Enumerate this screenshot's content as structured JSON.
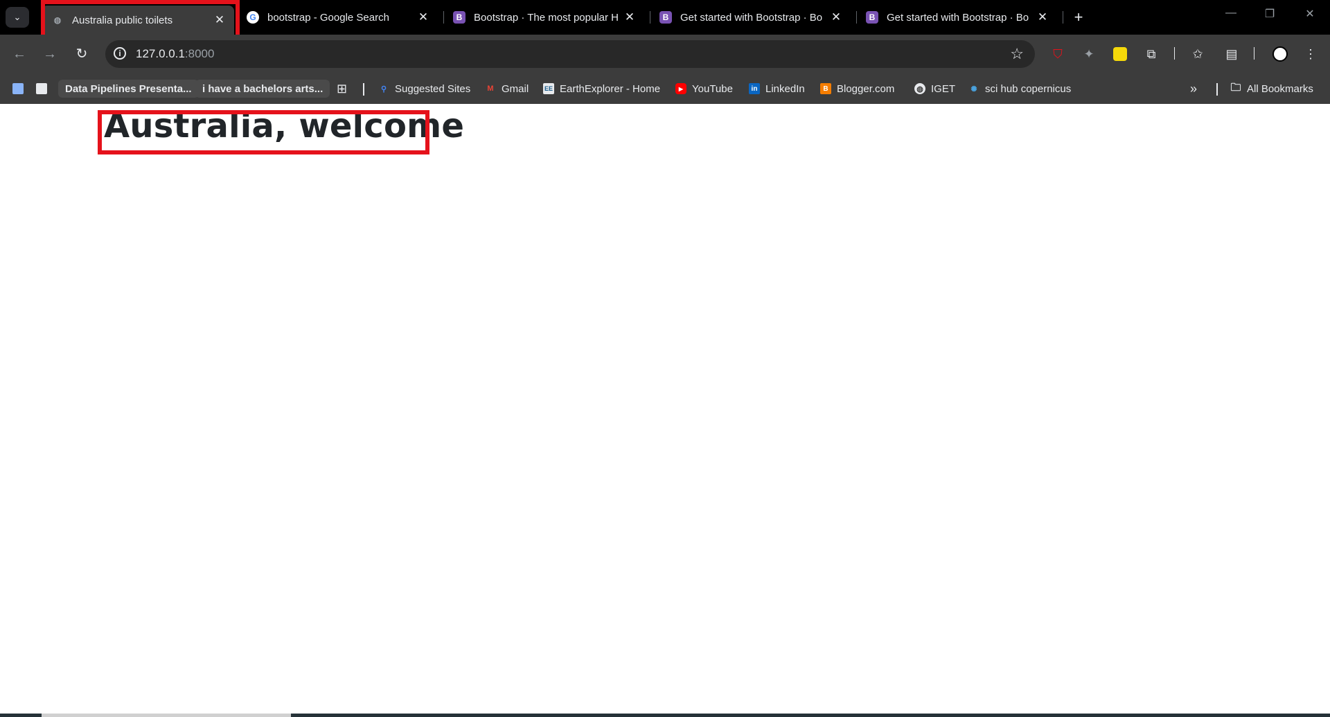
{
  "browser": {
    "tabs": [
      {
        "title": "Australia public toilets",
        "favicon": "globe-icon",
        "active": true
      },
      {
        "title": "bootstrap - Google Search",
        "favicon": "google-icon",
        "active": false
      },
      {
        "title": "Bootstrap · The most popular H",
        "favicon": "bootstrap-icon",
        "active": false
      },
      {
        "title": "Get started with Bootstrap · Bo",
        "favicon": "bootstrap-icon",
        "active": false
      },
      {
        "title": "Get started with Bootstrap · Bo",
        "favicon": "bootstrap-icon",
        "active": false
      }
    ],
    "address": {
      "host": "127.0.0.1",
      "port": ":8000"
    },
    "bookmarks": [
      {
        "label": "Data Pipelines Presenta...",
        "icon": "doc-icon"
      },
      {
        "label": "i have a bachelors arts...",
        "icon": "chat-icon"
      },
      {
        "label": "Suggested Sites",
        "icon": "search-icon"
      },
      {
        "label": "Gmail",
        "icon": "gmail-icon"
      },
      {
        "label": "EarthExplorer - Home",
        "icon": "earthexplorer-icon"
      },
      {
        "label": "YouTube",
        "icon": "youtube-icon"
      },
      {
        "label": "LinkedIn",
        "icon": "linkedin-icon"
      },
      {
        "label": "Blogger.com",
        "icon": "blogger-icon"
      },
      {
        "label": "IGET",
        "icon": "globe-icon"
      },
      {
        "label": "sci hub copernicus",
        "icon": "copernicus-icon"
      }
    ],
    "all_bookmarks_label": "All Bookmarks",
    "colors": {
      "highlight": "#e5121b",
      "bootstrap": "#7952b3"
    }
  },
  "page": {
    "heading": "Australia, welcome"
  }
}
